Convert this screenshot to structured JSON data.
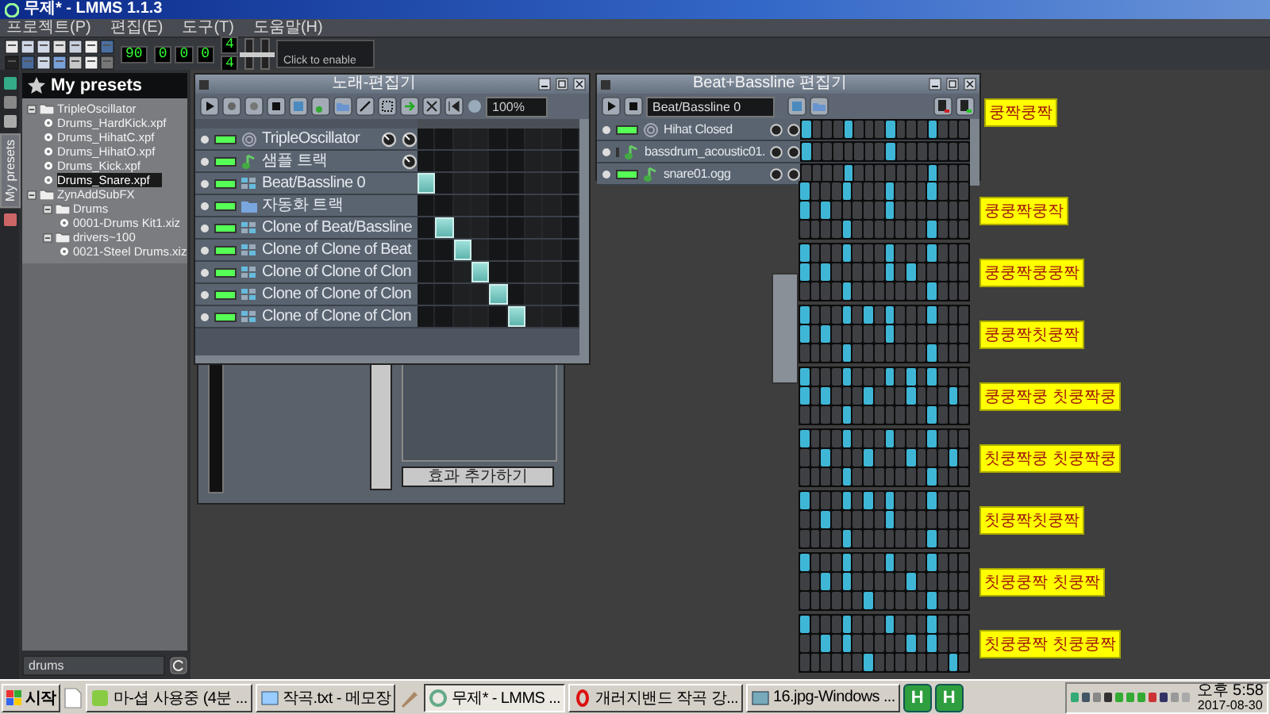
{
  "window": {
    "title": "무제* - LMMS 1.1.3"
  },
  "menu": [
    "프로젝트(P)",
    "편집(E)",
    "도구(T)",
    "도움말(H)"
  ],
  "toolbar": {
    "tempo": "90",
    "time": [
      "0",
      "0",
      "0"
    ],
    "time_signature": [
      "4",
      "4"
    ],
    "sliders": [
      {
        "level": 0.45
      },
      {
        "level": 0.45
      }
    ],
    "cpu_meter": "Click to enable"
  },
  "sidebar": {
    "tab": "My presets",
    "title": "My presets",
    "tree": [
      {
        "kind": "folder",
        "label": "TripleOscillator",
        "expanded": true,
        "children": [
          {
            "kind": "file",
            "label": "Drums_HardKick.xpf",
            "selected": false
          },
          {
            "kind": "file",
            "label": "Drums_HihatC.xpf",
            "selected": false
          },
          {
            "kind": "file",
            "label": "Drums_HihatO.xpf",
            "selected": false
          },
          {
            "kind": "file",
            "label": "Drums_Kick.xpf",
            "selected": false
          },
          {
            "kind": "file",
            "label": "Drums_Snare.xpf",
            "selected": true
          }
        ]
      },
      {
        "kind": "folder",
        "label": "ZynAddSubFX",
        "expanded": true,
        "children": [
          {
            "kind": "folder",
            "label": "Drums",
            "expanded": true,
            "children": [
              {
                "kind": "file",
                "label": "0001-Drums Kit1.xiz",
                "selected": false
              }
            ]
          },
          {
            "kind": "folder",
            "label": "drivers~100",
            "expanded": true,
            "children": [
              {
                "kind": "file",
                "label": "0021-Steel Drums.xiz",
                "selected": false
              }
            ]
          }
        ]
      }
    ],
    "search": {
      "value": "drums"
    }
  },
  "song_editor": {
    "title": "노래-편집기",
    "zoom": "100%",
    "tracks": [
      {
        "kind": "instrument",
        "name": "TripleOscillator",
        "bars": [
          false,
          false,
          false,
          false,
          false,
          false,
          false,
          false,
          false
        ]
      },
      {
        "kind": "sample",
        "name": "샘플 트랙",
        "bars": [
          false,
          false,
          false,
          false,
          false,
          false,
          false,
          false,
          false
        ]
      },
      {
        "kind": "beat",
        "name": "Beat/Bassline 0",
        "bars": [
          true,
          false,
          false,
          false,
          false,
          false,
          false,
          false,
          false
        ]
      },
      {
        "kind": "automation",
        "name": "자동화 트랙",
        "bars": [
          false,
          false,
          false,
          false,
          false,
          false,
          false,
          false,
          false
        ]
      },
      {
        "kind": "beat",
        "name": "Clone of Beat/Bassline",
        "bars": [
          false,
          true,
          false,
          false,
          false,
          false,
          false,
          false,
          false
        ]
      },
      {
        "kind": "beat",
        "name": "Clone of Clone of Beat",
        "bars": [
          false,
          false,
          true,
          false,
          false,
          false,
          false,
          false,
          false
        ]
      },
      {
        "kind": "beat",
        "name": "Clone of Clone of Clon",
        "bars": [
          false,
          false,
          false,
          true,
          false,
          false,
          false,
          false,
          false
        ]
      },
      {
        "kind": "beat",
        "name": "Clone of Clone of Clon",
        "bars": [
          false,
          false,
          false,
          false,
          true,
          false,
          false,
          false,
          false
        ]
      },
      {
        "kind": "beat",
        "name": "Clone of Clone of Clon",
        "bars": [
          false,
          false,
          false,
          false,
          false,
          true,
          false,
          false,
          false
        ]
      }
    ]
  },
  "fx_window": {
    "button": "효과 추가하기"
  },
  "bb_editor": {
    "title": "Beat+Bassline 편집기",
    "pattern": "Beat/Bassline 0",
    "note": "쿵짝쿵짝",
    "tracks": [
      {
        "kind": "instrument",
        "name": "Hihat Closed",
        "steps": [
          true,
          false,
          false,
          false,
          true,
          false,
          false,
          false,
          true,
          false,
          false,
          false,
          true,
          false,
          false,
          false
        ]
      },
      {
        "kind": "sample",
        "name": "bassdrum_acoustic01.",
        "steps": [
          true,
          false,
          false,
          false,
          false,
          false,
          false,
          false,
          true,
          false,
          false,
          false,
          false,
          false,
          false,
          false
        ]
      },
      {
        "kind": "sample",
        "name": "snare01.ogg",
        "steps": [
          false,
          false,
          false,
          false,
          true,
          false,
          false,
          false,
          false,
          false,
          false,
          false,
          true,
          false,
          false,
          false
        ]
      }
    ]
  },
  "patterns": [
    {
      "label": "쿵쿵짝쿵작",
      "rows": [
        [
          true,
          false,
          false,
          false,
          true,
          false,
          false,
          false,
          true,
          false,
          false,
          false,
          true,
          false,
          false,
          false
        ],
        [
          true,
          false,
          true,
          false,
          false,
          false,
          false,
          false,
          true,
          false,
          false,
          false,
          false,
          false,
          false,
          false
        ],
        [
          false,
          false,
          false,
          false,
          true,
          false,
          false,
          false,
          false,
          false,
          false,
          false,
          true,
          false,
          false,
          false
        ]
      ]
    },
    {
      "label": "쿵쿵짝쿵쿵짝",
      "rows": [
        [
          true,
          false,
          false,
          false,
          true,
          false,
          false,
          false,
          true,
          false,
          false,
          false,
          true,
          false,
          false,
          false
        ],
        [
          true,
          false,
          true,
          false,
          false,
          false,
          false,
          false,
          true,
          false,
          true,
          false,
          false,
          false,
          false,
          false
        ],
        [
          false,
          false,
          false,
          false,
          true,
          false,
          false,
          false,
          false,
          false,
          false,
          false,
          true,
          false,
          false,
          false
        ]
      ]
    },
    {
      "label": "쿵쿵짝칫쿵짝",
      "rows": [
        [
          true,
          false,
          false,
          false,
          true,
          false,
          true,
          false,
          true,
          false,
          false,
          false,
          true,
          false,
          false,
          false
        ],
        [
          true,
          false,
          true,
          false,
          false,
          false,
          false,
          false,
          true,
          false,
          false,
          false,
          false,
          false,
          false,
          false
        ],
        [
          false,
          false,
          false,
          false,
          true,
          false,
          false,
          false,
          false,
          false,
          false,
          false,
          true,
          false,
          false,
          false
        ]
      ]
    },
    {
      "label": "쿵쿵짝쿵 칫쿵짝쿵",
      "rows": [
        [
          true,
          false,
          false,
          false,
          true,
          false,
          false,
          false,
          true,
          false,
          true,
          false,
          true,
          false,
          false,
          false
        ],
        [
          true,
          false,
          true,
          false,
          false,
          false,
          true,
          false,
          false,
          false,
          true,
          false,
          false,
          false,
          true,
          false
        ],
        [
          false,
          false,
          false,
          false,
          true,
          false,
          false,
          false,
          false,
          false,
          false,
          false,
          true,
          false,
          false,
          false
        ]
      ]
    },
    {
      "label": "칫쿵짝쿵 칫쿵짝쿵",
      "rows": [
        [
          true,
          false,
          false,
          false,
          true,
          false,
          false,
          false,
          true,
          false,
          false,
          false,
          true,
          false,
          false,
          false
        ],
        [
          false,
          false,
          true,
          false,
          false,
          false,
          true,
          false,
          false,
          false,
          true,
          false,
          false,
          false,
          true,
          false
        ],
        [
          false,
          false,
          false,
          false,
          true,
          false,
          false,
          false,
          false,
          false,
          false,
          false,
          true,
          false,
          false,
          false
        ]
      ]
    },
    {
      "label": "칫쿵짝칫쿵짝",
      "rows": [
        [
          true,
          false,
          false,
          false,
          true,
          false,
          true,
          false,
          true,
          false,
          false,
          false,
          true,
          false,
          false,
          false
        ],
        [
          false,
          false,
          true,
          false,
          false,
          false,
          false,
          false,
          true,
          false,
          false,
          false,
          false,
          false,
          false,
          false
        ],
        [
          false,
          false,
          false,
          false,
          true,
          false,
          false,
          false,
          false,
          false,
          false,
          false,
          true,
          false,
          false,
          false
        ]
      ]
    },
    {
      "label": "칫쿵쿵짝 칫쿵짝",
      "rows": [
        [
          true,
          false,
          false,
          false,
          true,
          false,
          false,
          false,
          true,
          false,
          false,
          false,
          true,
          false,
          false,
          false
        ],
        [
          false,
          false,
          true,
          false,
          true,
          false,
          false,
          false,
          false,
          false,
          true,
          false,
          false,
          false,
          false,
          false
        ],
        [
          false,
          false,
          false,
          false,
          false,
          false,
          true,
          false,
          false,
          false,
          false,
          false,
          true,
          false,
          false,
          false
        ]
      ]
    },
    {
      "label": "칫쿵쿵짝 칫쿵쿵짝",
      "rows": [
        [
          true,
          false,
          false,
          false,
          true,
          false,
          false,
          false,
          true,
          false,
          false,
          false,
          true,
          false,
          false,
          false
        ],
        [
          false,
          false,
          true,
          false,
          true,
          false,
          false,
          false,
          false,
          false,
          true,
          false,
          true,
          false,
          false,
          false
        ],
        [
          false,
          false,
          false,
          false,
          false,
          false,
          true,
          false,
          false,
          false,
          false,
          false,
          false,
          false,
          true,
          false
        ]
      ]
    }
  ],
  "taskbar": {
    "start": "시작",
    "items": [
      {
        "label": "마-셥 사용중 (4분 ...",
        "selected": false
      },
      {
        "label": "작곡.txt - 메모장",
        "selected": false
      },
      {
        "label": "무제* - LMMS ...",
        "selected": true
      },
      {
        "label": "개러지밴드 작곡 강...",
        "selected": false
      },
      {
        "label": "16.jpg-Windows ...",
        "selected": false
      }
    ],
    "quick_launch": [
      "H",
      "H"
    ],
    "clock": {
      "time": "오후 5:58",
      "date": "2017-08-30"
    }
  }
}
